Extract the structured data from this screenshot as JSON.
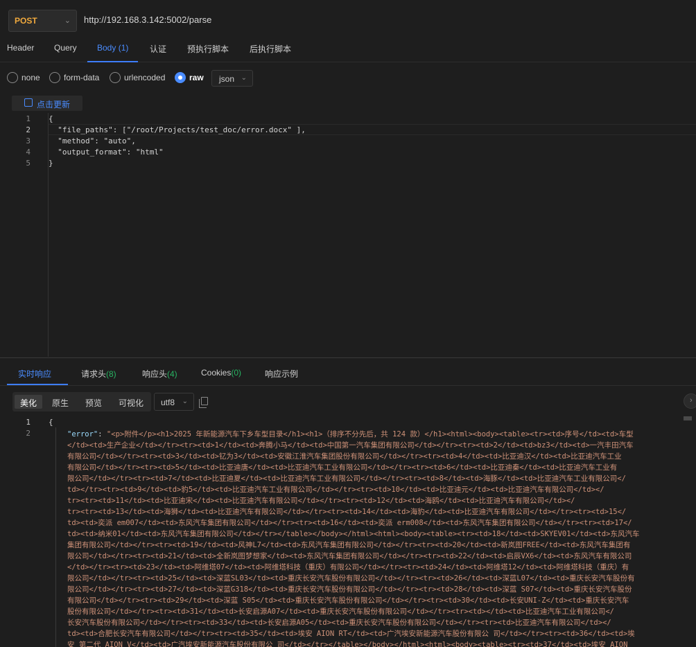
{
  "request": {
    "method": "POST",
    "url": "http://192.168.3.142:5002/parse"
  },
  "request_tabs": [
    {
      "label": "Header",
      "count": ""
    },
    {
      "label": "Query",
      "count": ""
    },
    {
      "label": "Body",
      "count": "(1)"
    },
    {
      "label": "认证",
      "count": ""
    },
    {
      "label": "预执行脚本",
      "count": ""
    },
    {
      "label": "后执行脚本",
      "count": ""
    }
  ],
  "body_types": [
    "none",
    "form-data",
    "urlencoded",
    "raw"
  ],
  "body_format": "json",
  "update_button": "点击更新",
  "editor": {
    "line_numbers": [
      "1",
      "2",
      "3",
      "4",
      "5"
    ],
    "lines": [
      "{",
      "  \"file_paths\": [\"/root/Projects/test_doc/error.docx\" ],",
      "  \"method\": \"auto\",",
      "  \"output_format\": \"html\"",
      "}"
    ]
  },
  "response_tabs": [
    {
      "label": "实时响应",
      "count": ""
    },
    {
      "label": "请求头",
      "count": "(8)"
    },
    {
      "label": "响应头",
      "count": "(4)"
    },
    {
      "label": "Cookies",
      "count": "(0)"
    },
    {
      "label": "响应示例",
      "count": ""
    }
  ],
  "view_modes": [
    "美化",
    "原生",
    "预览",
    "可视化"
  ],
  "encoding": "utf8",
  "response": {
    "line_numbers": [
      "1",
      "2"
    ],
    "open_brace": "{",
    "key": "\"error\"",
    "lines": [
      "\"<p>附件</p><h1>2025 年新能源汽车下乡车型目录</h1><h1>（排序不分先后，共 124 款）</h1><html><body><table><tr><td>序号</td><td>车型",
      "</td><td>生产企业</td></tr><tr><td>1</td><td>奔腾小马</td><td>中国第一汽车集团有限公司</td></tr><tr><td>2</td><td>bz3</td><td>一汽丰田汽车",
      "有限公司</td></tr><tr><td>3</td><td>钇为3</td><td>安徽江淮汽车集团股份有限公司</td></tr><tr><td>4</td><td>比亚迪汉</td><td>比亚迪汽车工业",
      "有限公司</td></tr><tr><td>5</td><td>比亚迪唐</td><td>比亚迪汽车工业有限公司</td></tr><tr><td>6</td><td>比亚迪秦</td><td>比亚迪汽车工业有",
      "限公司</td></tr><tr><td>7</td><td>比亚迪夏</td><td>比亚迪汽车工业有限公司</td></tr><tr><td>8</td><td>海豚</td><td>比亚迪汽车工业有限公司</",
      "td></tr><tr><td>9</td><td>豹5</td><td>比亚迪汽车工业有限公司</td></tr><tr><td>10</td><td>比亚迪元</td><td>比亚迪汽车有限公司</td></",
      "tr><tr><td>11</td><td>比亚迪宋</td><td>比亚迪汽车有限公司</td></tr><tr><td>12</td><td>海鸥</td><td>比亚迪汽车有限公司</td></",
      "tr><tr><td>13</td><td>海狮</td><td>比亚迪汽车有限公司</td></tr><tr><td>14</td><td>海豹</td><td>比亚迪汽车有限公司</td></tr><tr><td>15</",
      "td><td>奕派 em007</td><td>东风汽车集团有限公司</td></tr><tr><td>16</td><td>奕派 erm008</td><td>东风汽车集团有限公司</td></tr><tr><td>17</",
      "td><td>纳米01</td><td>东风汽车集团有限公司</td></tr></table></body></html><html><body><table><tr><td>18</td><td>SKYEV01</td><td>东风汽车",
      "集团有限公司</td></tr><tr><td>19</td><td>风神L7</td><td>东风汽车集团有限公司</td></tr><tr><td>20</td><td>新岚图FREE</td><td>东风汽车集团有",
      "限公司</td></tr><tr><td>21</td><td>全新岚图梦想家</td><td>东风汽车集团有限公司</td></tr><tr><td>22</td><td>启辰VX6</td><td>东风汽车有限公司",
      "</td></tr><tr><td>23</td><td>阿维塔07</td><td>阿维塔科技（重庆）有限公司</td></tr><tr><td>24</td><td>阿维塔12</td><td>阿维塔科技（重庆）有",
      "限公司</td></tr><tr><td>25</td><td>深蓝SL03</td><td>重庆长安汽车股份有限公司</td></tr><tr><td>26</td><td>深蓝L07</td><td>重庆长安汽车股份有",
      "限公司</td></tr><tr><td>27</td><td>深蓝G318</td><td>重庆长安汽车股份有限公司</td></tr><tr><td>28</td><td>深蓝 S07</td><td>重庆长安汽车股份",
      "有限公司</td></tr><tr><td>29</td><td>深蓝 S05</td><td>重庆长安汽车股份有限公司</td></tr><tr><td>30</td><td>长安UNI-Z</td><td>重庆长安汽车",
      "股份有限公司</td></tr><tr><td>31</td><td>长安启源A07</td><td>重庆长安汽车股份有限公司</td></tr><tr><td></td><td>比亚迪汽车工业有限公司</",
      "长安汽车股份有限公司</td></tr><tr><td>33</td><td>长安启源A05</td><td>重庆长安汽车股份有限公司</td></tr><tr><td>比亚迪汽车有限公司</td></",
      "td><td>合肥长安汽车有限公司</td></tr><tr><td>35</td><td>埃安 AION RT</td><td>广汽埃安新能源汽车股份有限公 司</td></tr><tr><td>36</td><td>埃",
      "安 第二代 AION V</td><td>广汽埃安新能源汽车股份有限公 司</td></tr></table></body></html><html><body><table><tr><td>37</td><td>埃安 AION"
    ]
  }
}
